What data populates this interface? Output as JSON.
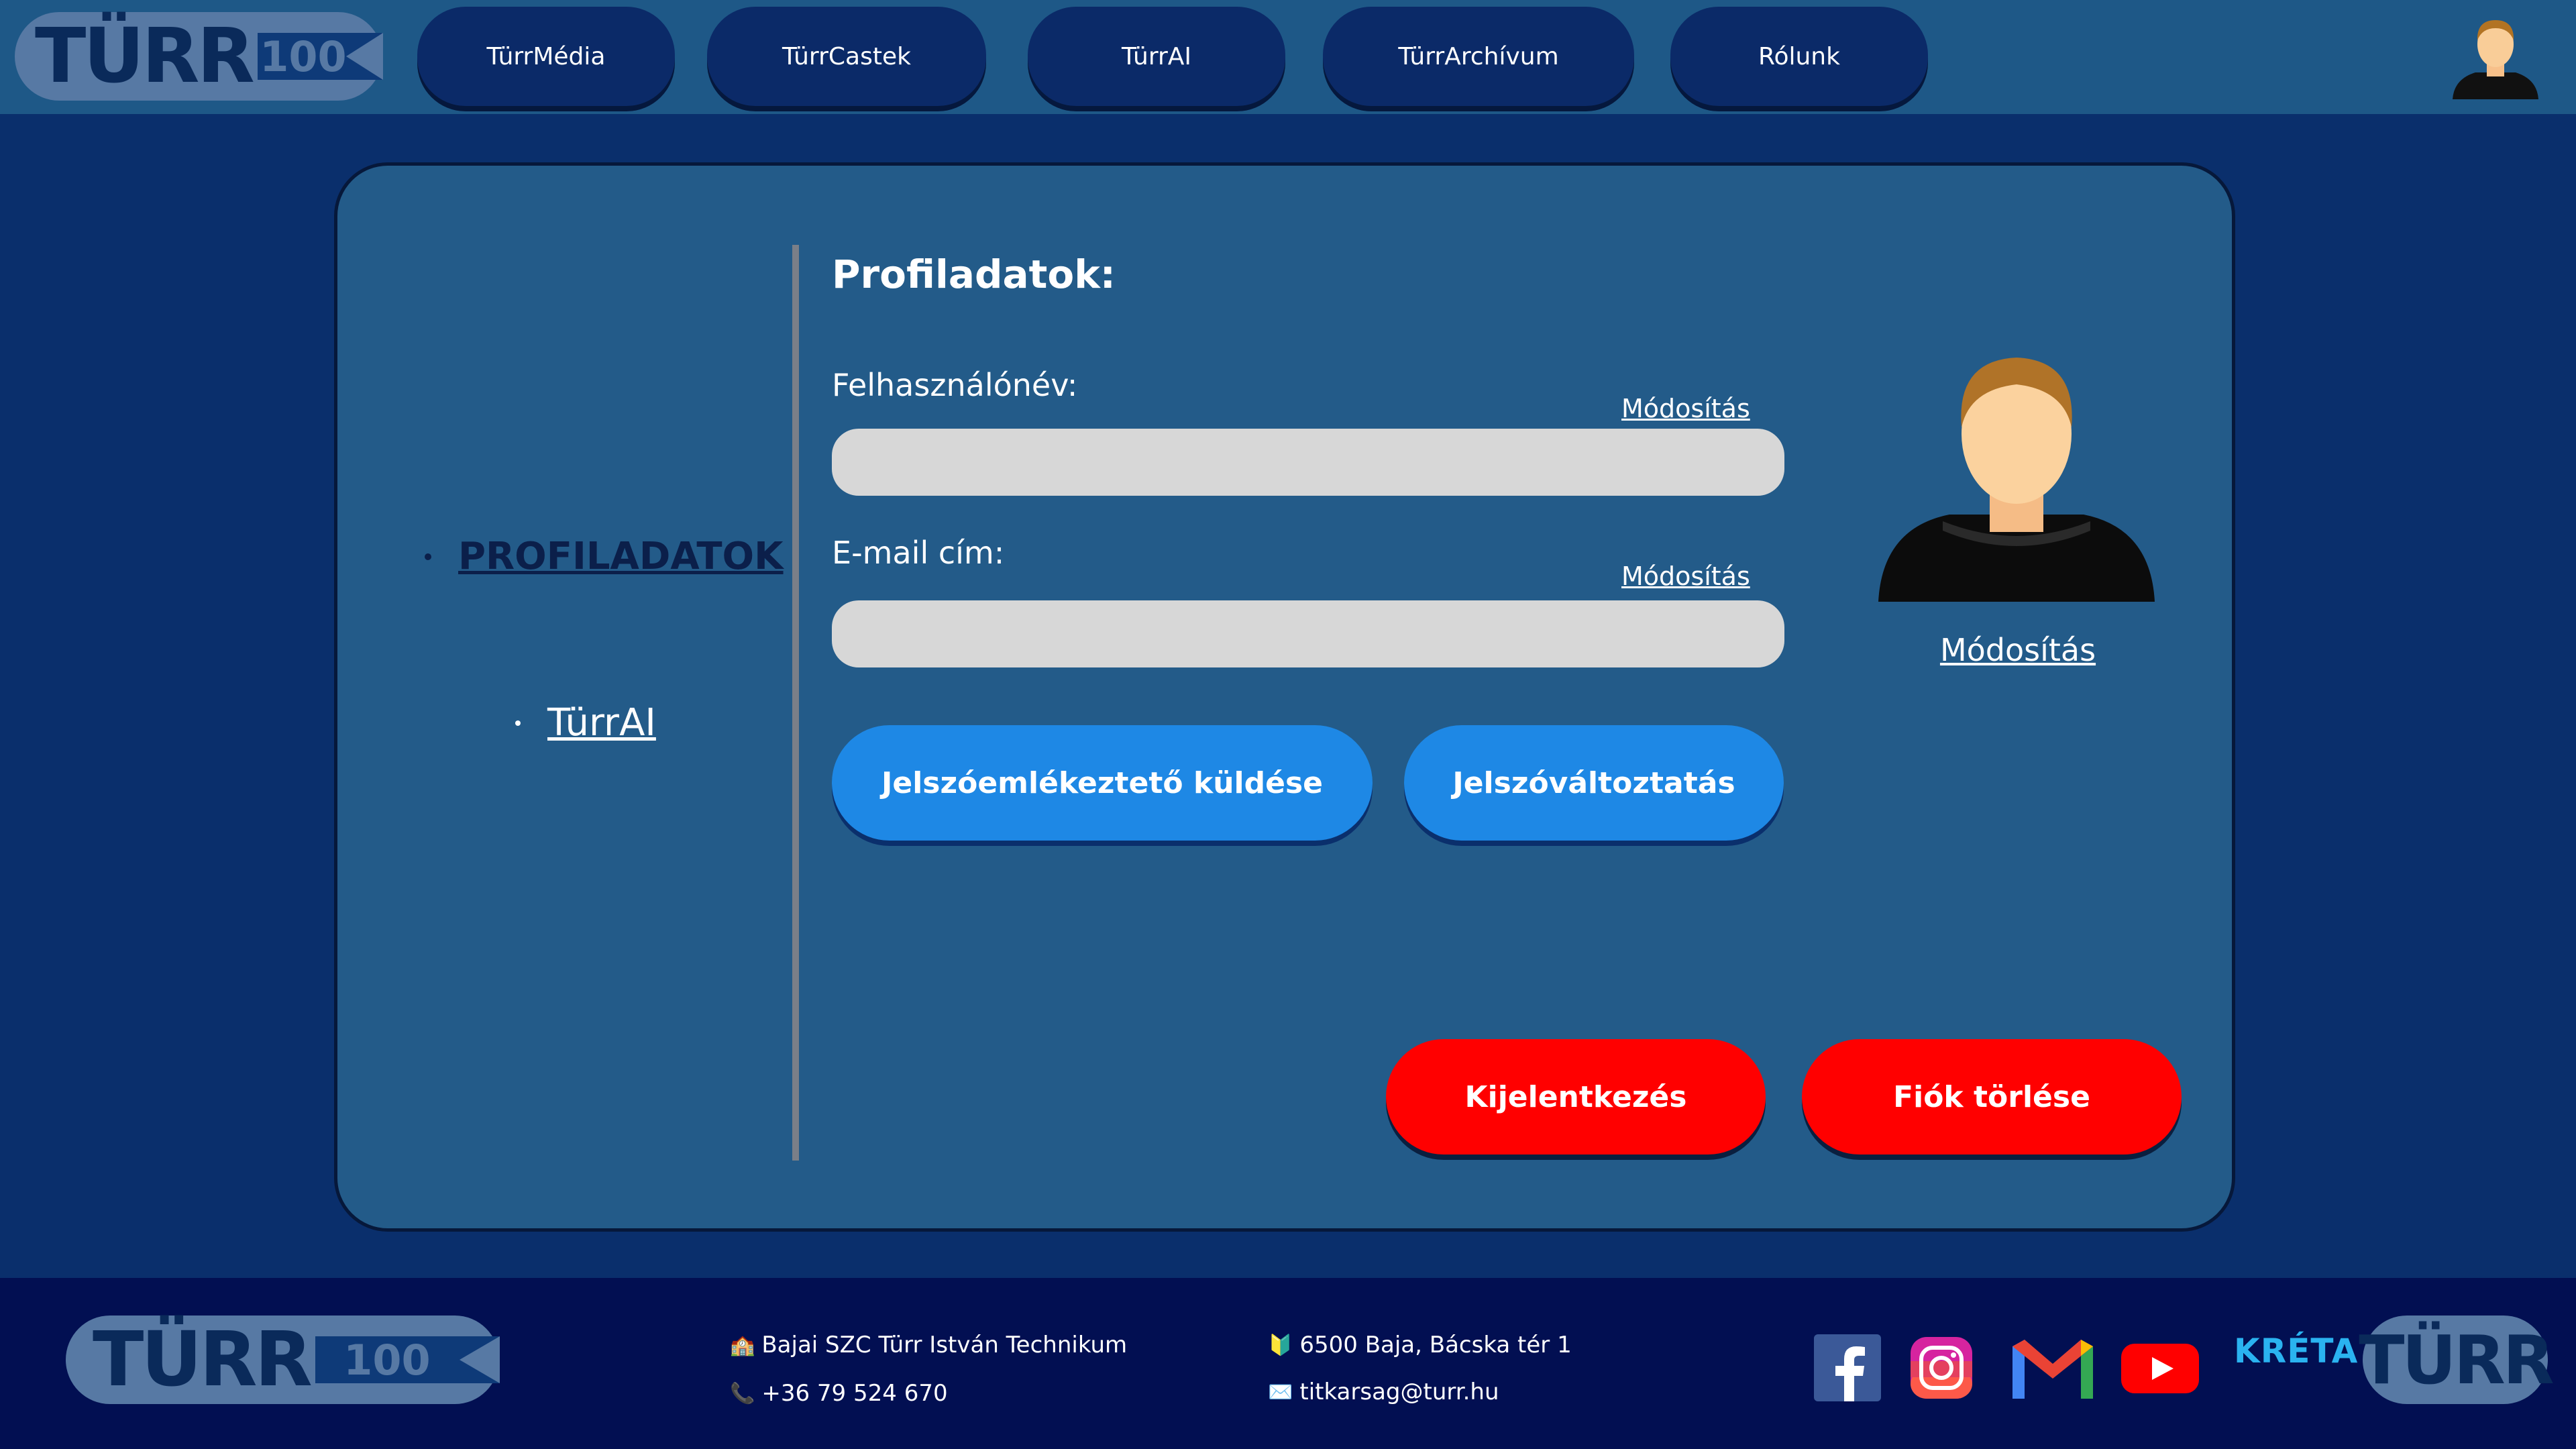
{
  "header": {
    "logo": {
      "word": "TÜRR",
      "badge": "100"
    },
    "nav": [
      {
        "label": "TürrMédia"
      },
      {
        "label": "TürrCastek"
      },
      {
        "label": "TürrAI"
      },
      {
        "label": "TürrArchívum"
      },
      {
        "label": "Rólunk"
      }
    ],
    "profile_icon": "user-avatar-icon"
  },
  "sidebar": {
    "items": [
      {
        "label": "PROFILADATOK",
        "active": true
      },
      {
        "label": "TürrAI",
        "active": false
      }
    ]
  },
  "profile": {
    "title": "Profiladatok:",
    "username": {
      "label": "Felhasználónév:",
      "modify_label": "Módosítás",
      "value": "",
      "placeholder": ""
    },
    "email": {
      "label": "E-mail cím:",
      "modify_label": "Módosítás",
      "value": "",
      "placeholder": ""
    },
    "reminder_button": "Jelszóemlékeztető küldése",
    "change_password_button": "Jelszóváltoztatás",
    "avatar_modify_label": "Módosítás",
    "logout_button": "Kijelentkezés",
    "delete_account_button": "Fiók törlése"
  },
  "footer": {
    "logo": {
      "word": "TÜRR",
      "badge": "100"
    },
    "school_icon": "🏫",
    "school": "Bajai SZC Türr István Technikum",
    "phone_icon": "📞",
    "phone": "+36 79 524 670",
    "address_icon": "🔰",
    "address": "6500 Baja, Bácska tér 1",
    "email_icon": "✉️",
    "email": "titkarsag@turr.hu",
    "social": [
      "facebook-icon",
      "instagram-icon",
      "gmail-icon",
      "youtube-icon"
    ],
    "kreta": "KRÉTA",
    "logo2": "TÜRR"
  },
  "colors": {
    "page_bg": "#0a2f6c",
    "header_bg": "#1e5887",
    "card_bg": "#235b89",
    "nav_button": "#0b2a68",
    "primary_button": "#1e88e5",
    "danger_button": "#ff0000",
    "footer_bg": "#020f52",
    "input_bg": "#d7d7d7"
  }
}
